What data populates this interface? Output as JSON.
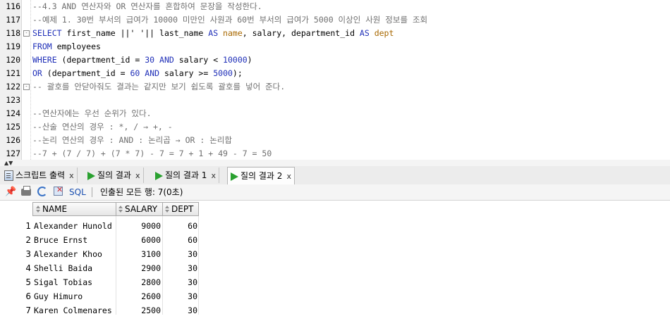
{
  "editor": {
    "lines": [
      {
        "num": "116",
        "fold": "",
        "tokens": [
          {
            "t": "--4.3 AND 연산자와 OR 연산자를 혼합하여 문장을 작성한다.",
            "c": "c-cmt"
          }
        ]
      },
      {
        "num": "117",
        "fold": "",
        "tokens": [
          {
            "t": "--예제 1. 30번 부서의 급여가 10000 미만인 사원과 60번 부서의 급여가 5000 이상인 사원 정보를 조회",
            "c": "c-cmt"
          }
        ]
      },
      {
        "num": "118",
        "fold": "⊟",
        "tokens": [
          {
            "t": "SELECT ",
            "c": "c-kw"
          },
          {
            "t": "first_name ||' '|| last_name ",
            "c": "c-id"
          },
          {
            "t": "AS ",
            "c": "c-kw"
          },
          {
            "t": "name",
            "c": "c-alias"
          },
          {
            "t": ", salary, department_id ",
            "c": "c-id"
          },
          {
            "t": "AS ",
            "c": "c-kw"
          },
          {
            "t": "dept",
            "c": "c-alias"
          }
        ]
      },
      {
        "num": "119",
        "fold": "",
        "tokens": [
          {
            "t": "FROM ",
            "c": "c-kw"
          },
          {
            "t": "employees",
            "c": "c-id"
          }
        ]
      },
      {
        "num": "120",
        "fold": "",
        "tokens": [
          {
            "t": "WHERE ",
            "c": "c-kw"
          },
          {
            "t": "(department_id = ",
            "c": "c-id"
          },
          {
            "t": "30",
            "c": "c-num"
          },
          {
            "t": " AND ",
            "c": "c-kw"
          },
          {
            "t": "salary < ",
            "c": "c-id"
          },
          {
            "t": "10000",
            "c": "c-num"
          },
          {
            "t": ")",
            "c": "c-id"
          }
        ]
      },
      {
        "num": "121",
        "fold": "",
        "tokens": [
          {
            "t": "OR ",
            "c": "c-kw"
          },
          {
            "t": "(department_id = ",
            "c": "c-id"
          },
          {
            "t": "60",
            "c": "c-num"
          },
          {
            "t": " AND ",
            "c": "c-kw"
          },
          {
            "t": "salary >= ",
            "c": "c-id"
          },
          {
            "t": "5000",
            "c": "c-num"
          },
          {
            "t": ");",
            "c": "c-id"
          }
        ]
      },
      {
        "num": "122",
        "fold": "⊟",
        "tokens": [
          {
            "t": "-- 괄호를 안닫아줘도 결과는 같지만 보기 쉽도록 괄호를 넣어 준다.",
            "c": "c-cmt"
          }
        ]
      },
      {
        "num": "123",
        "fold": "",
        "tokens": [
          {
            "t": "",
            "c": "c-id"
          }
        ]
      },
      {
        "num": "124",
        "fold": "",
        "tokens": [
          {
            "t": "--연산자에는 우선 순위가 있다.",
            "c": "c-cmt"
          }
        ]
      },
      {
        "num": "125",
        "fold": "",
        "tokens": [
          {
            "t": "--산술 연산의 경우 : *, / → +, -",
            "c": "c-cmt"
          }
        ]
      },
      {
        "num": "126",
        "fold": "",
        "tokens": [
          {
            "t": "--논리 연산의 경우 : AND : 논리곱 → OR : 논리합",
            "c": "c-cmt"
          }
        ]
      },
      {
        "num": "127",
        "fold": "",
        "tokens": [
          {
            "t": "--7 + (7 / 7) + (7 * 7) - 7 = 7 + 1 + 49 - 7 = 50",
            "c": "c-cmt"
          }
        ]
      }
    ]
  },
  "tabs": [
    {
      "label": "스크립트 출력",
      "icon": "script-output-icon",
      "active": false
    },
    {
      "label": "질의 결과",
      "icon": "run-icon",
      "active": false
    },
    {
      "label": "질의 결과 1",
      "icon": "run-icon",
      "active": false
    },
    {
      "label": "질의 결과 2",
      "icon": "run-icon",
      "active": true
    }
  ],
  "tab_close": "x",
  "toolbar": {
    "sql_label": "SQL",
    "fetch_text": "인출된 모든 행: 7(0초)"
  },
  "grid": {
    "columns": [
      "NAME",
      "SALARY",
      "DEPT"
    ],
    "rows": [
      {
        "n": "1",
        "name": "Alexander Hunold",
        "salary": "9000",
        "dept": "60"
      },
      {
        "n": "2",
        "name": "Bruce Ernst",
        "salary": "6000",
        "dept": "60"
      },
      {
        "n": "3",
        "name": "Alexander Khoo",
        "salary": "3100",
        "dept": "30"
      },
      {
        "n": "4",
        "name": "Shelli Baida",
        "salary": "2900",
        "dept": "30"
      },
      {
        "n": "5",
        "name": "Sigal Tobias",
        "salary": "2800",
        "dept": "30"
      },
      {
        "n": "6",
        "name": "Guy Himuro",
        "salary": "2600",
        "dept": "30"
      },
      {
        "n": "7",
        "name": "Karen Colmenares",
        "salary": "2500",
        "dept": "30"
      }
    ]
  }
}
